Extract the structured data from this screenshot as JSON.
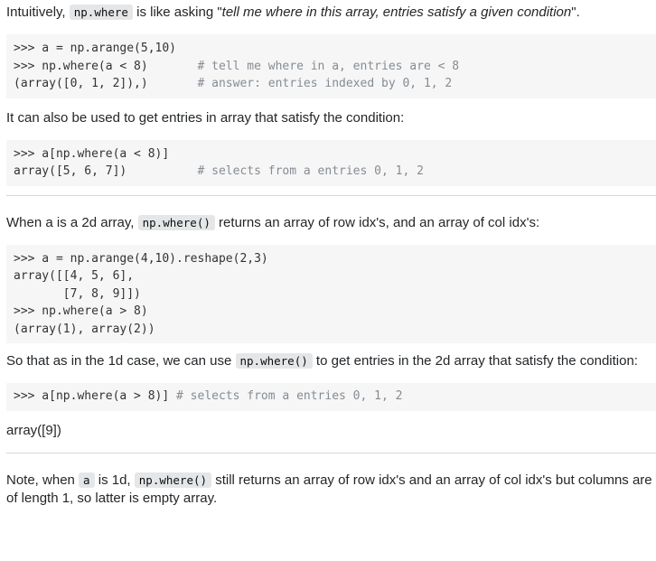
{
  "p1": {
    "t1": "Intuitively, ",
    "code": "np.where",
    "t2": " is like asking \"",
    "em": "tell me where in this array, entries satisfy a given condition",
    "t3": "\"."
  },
  "pre1": {
    "line1": ">>> a = np.arange(5,10)",
    "line2_code": ">>> np.where(a < 8)       ",
    "line2_comment": "# tell me where in a, entries are < 8",
    "line3_code": "(array([0, 1, 2]),)       ",
    "line3_comment": "# answer: entries indexed by 0, 1, 2"
  },
  "p2": {
    "text": "It can also be used to get entries in array that satisfy the condition:"
  },
  "pre2": {
    "line1": ">>> a[np.where(a < 8)]",
    "line2_code": "array([5, 6, 7])          ",
    "line2_comment": "# selects from a entries 0, 1, 2"
  },
  "p3": {
    "t1": "When a is a 2d array, ",
    "code": "np.where()",
    "t2": " returns an array of row idx's, and an array of col idx's:"
  },
  "pre3": {
    "line1": ">>> a = np.arange(4,10).reshape(2,3)",
    "line2": "array([[4, 5, 6],",
    "line3": "       [7, 8, 9]])",
    "line4": ">>> np.where(a > 8)",
    "line5": "(array(1), array(2))"
  },
  "p4": {
    "t1": "So that as in the 1d case, we can use ",
    "code": "np.where()",
    "t2": " to get entries in the 2d array that satisfy the condition:"
  },
  "pre4": {
    "line1_code": ">>> a[np.where(a > 8)] ",
    "line1_comment": "# selects from a entries 0, 1, 2"
  },
  "p5": {
    "text": "array([9])"
  },
  "p6": {
    "t1": "Note, when ",
    "code1": "a",
    "t2": " is 1d, ",
    "code2": "np.where()",
    "t3": " still returns an array of row idx's and an array of col idx's but columns are of length 1, so latter is empty array."
  }
}
